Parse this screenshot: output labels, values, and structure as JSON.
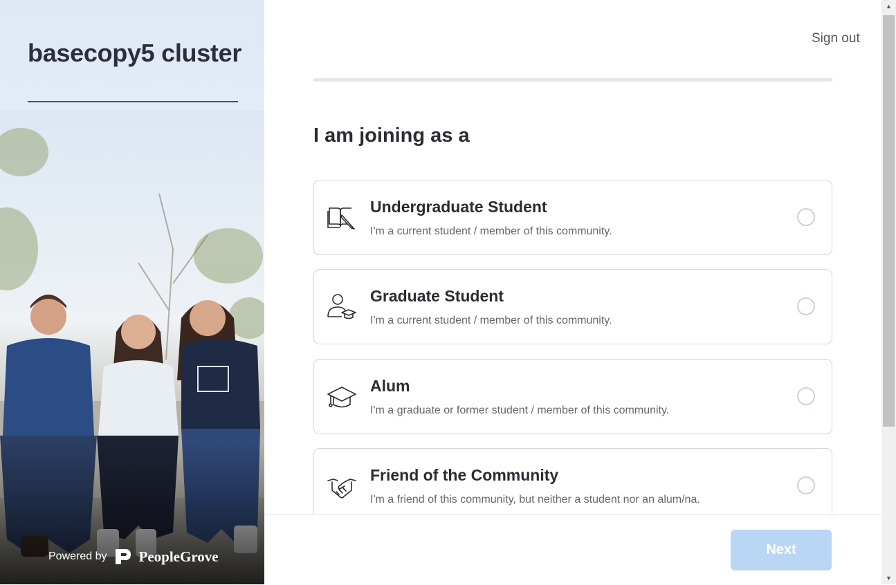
{
  "sidebar": {
    "community_name": "basecopy5 cluster",
    "powered_by": "Powered by",
    "brand": "PeopleGrove"
  },
  "header": {
    "sign_out": "Sign out"
  },
  "form": {
    "heading": "I am joining as a",
    "options": [
      {
        "label": "Undergraduate Student",
        "description": "I'm a current student / member of this community.",
        "icon": "book-pencil-icon",
        "selected": false
      },
      {
        "label": "Graduate Student",
        "description": "I'm a current student / member of this community.",
        "icon": "person-graduate-icon",
        "selected": false
      },
      {
        "label": "Alum",
        "description": "I'm a graduate or former student / member of this community.",
        "icon": "graduation-cap-icon",
        "selected": false
      },
      {
        "label": "Friend of the Community",
        "description": "I'm a friend of this community, but neither a student nor an alum/na.",
        "icon": "handshake-icon",
        "selected": false
      }
    ]
  },
  "footer": {
    "next_label": "Next",
    "next_enabled": false
  },
  "colors": {
    "next_disabled_bg": "#b9d7f5",
    "sidebar_bg": "#dfe9f6",
    "border": "#d3d6dc"
  }
}
